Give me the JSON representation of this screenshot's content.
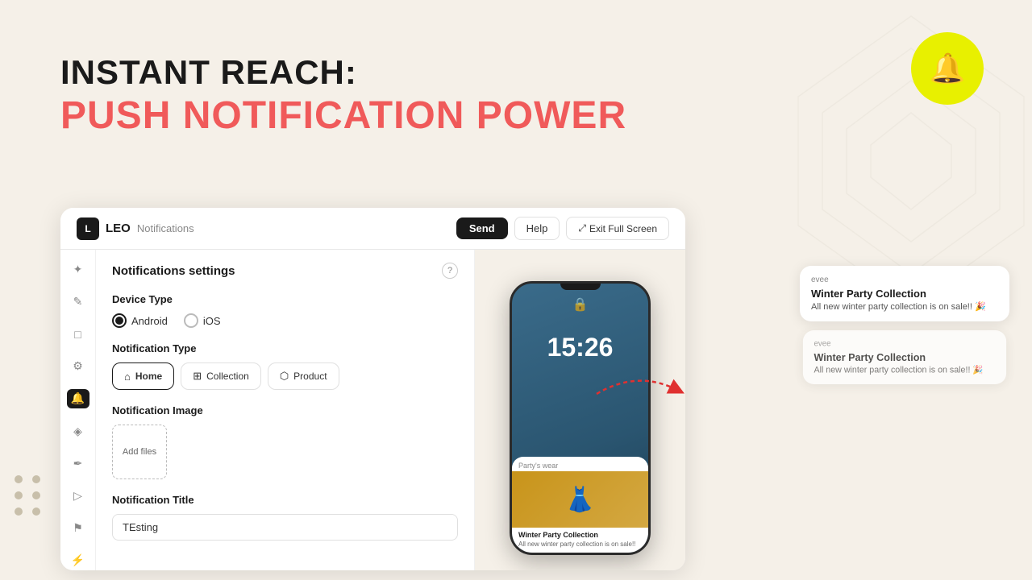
{
  "page": {
    "background_color": "#f5f0e8"
  },
  "headline": {
    "line1": "INSTANT REACH:",
    "line2": "PUSH NOTIFICATION POWER"
  },
  "bell": {
    "icon": "🔔"
  },
  "app": {
    "logo_text": "L",
    "name": "LEO",
    "subtitle": "Notifications",
    "buttons": {
      "send": "Send",
      "help": "Help",
      "fullscreen": "Exit Full Screen"
    }
  },
  "settings": {
    "title": "Notifications settings",
    "device_type": {
      "label": "Device Type",
      "options": [
        "Android",
        "iOS"
      ],
      "selected": "Android"
    },
    "notification_type": {
      "label": "Notification Type",
      "options": [
        "Home",
        "Collection",
        "Product"
      ],
      "selected": "Home"
    },
    "notification_image": {
      "label": "Notification Image",
      "add_files_label": "Add files"
    },
    "notification_title": {
      "label": "Notification Title",
      "value": "TEsting"
    }
  },
  "phone": {
    "time": "15:26",
    "card_tag": "Party's wear",
    "card_title": "Winter Party Collection",
    "card_subtitle": "All new winter party collection is on sale!!"
  },
  "notification_cards": [
    {
      "app": "evee",
      "title": "Winter Party Collection",
      "body": "All new winter party collection is on sale!! 🎉"
    },
    {
      "app": "evee",
      "title": "Winter Party Collection",
      "body": "All new winter party collection is on sale!! 🎉"
    }
  ],
  "sidebar_icons": [
    {
      "name": "sparkle-icon",
      "symbol": "✦",
      "active": false
    },
    {
      "name": "edit-icon",
      "symbol": "✎",
      "active": false
    },
    {
      "name": "file-icon",
      "symbol": "📄",
      "active": false
    },
    {
      "name": "settings-icon",
      "symbol": "⚙",
      "active": false
    },
    {
      "name": "bell-icon",
      "symbol": "🔔",
      "active": true
    },
    {
      "name": "tag-icon",
      "symbol": "🏷",
      "active": false
    },
    {
      "name": "pen-icon",
      "symbol": "✒",
      "active": false
    },
    {
      "name": "play-icon",
      "symbol": "▶",
      "active": false
    },
    {
      "name": "flag-icon",
      "symbol": "⚑",
      "active": false
    },
    {
      "name": "bolt-icon",
      "symbol": "⚡",
      "active": false
    }
  ]
}
